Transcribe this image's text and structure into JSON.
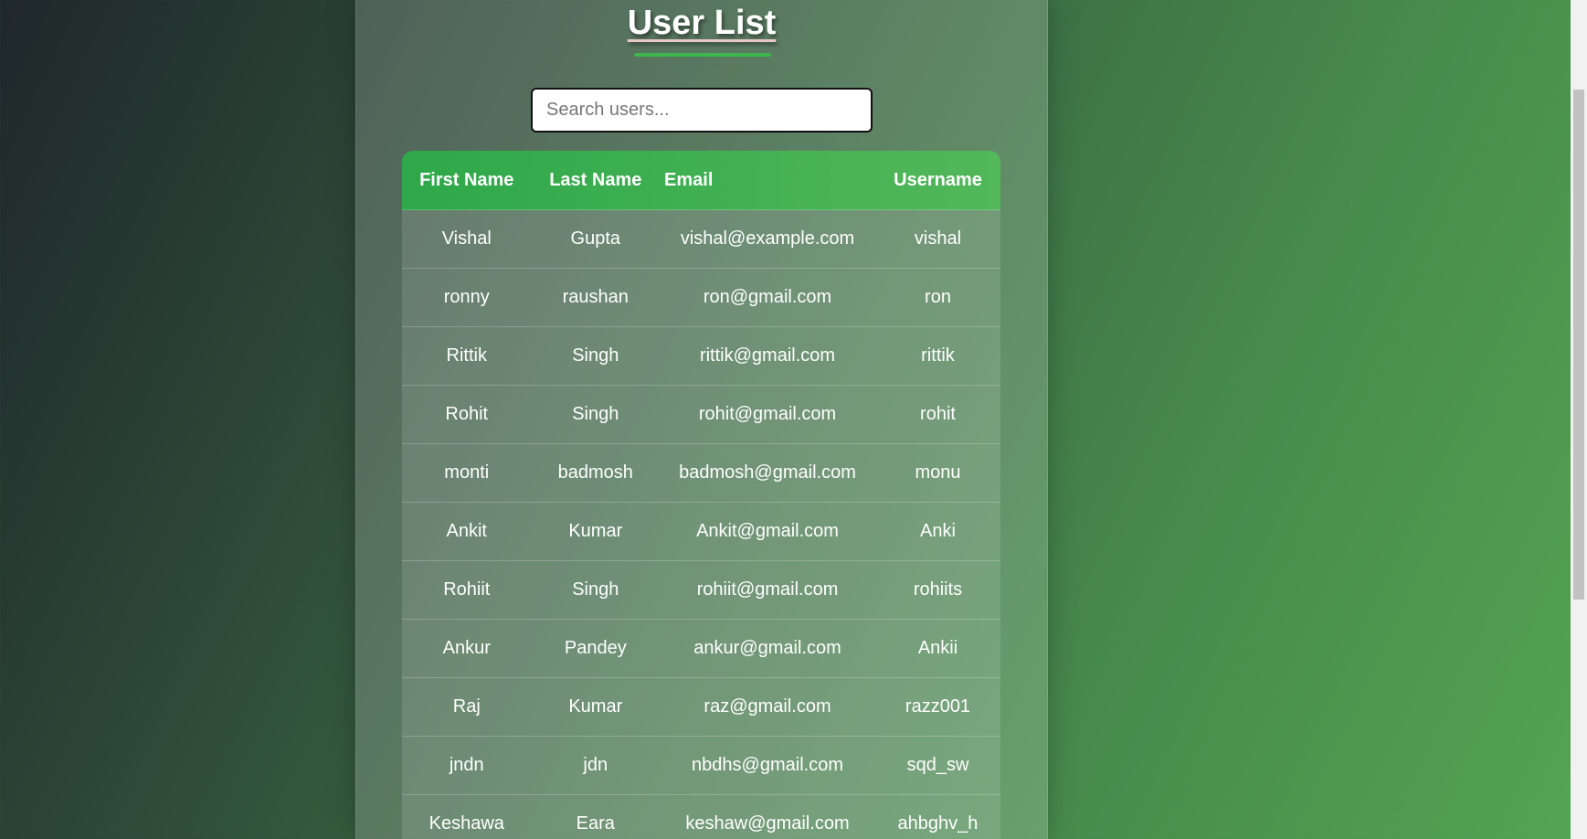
{
  "page": {
    "title": "User List",
    "search_placeholder": "Search users..."
  },
  "table": {
    "headers": [
      "First Name",
      "Last Name",
      "Email",
      "Username"
    ],
    "rows": [
      [
        "Vishal",
        "Gupta",
        "vishal@example.com",
        "vishal"
      ],
      [
        "ronny",
        "raushan",
        "ron@gmail.com",
        "ron"
      ],
      [
        "Rittik",
        "Singh",
        "rittik@gmail.com",
        "rittik"
      ],
      [
        "Rohit",
        "Singh",
        "rohit@gmail.com",
        "rohit"
      ],
      [
        "monti",
        "badmosh",
        "badmosh@gmail.com",
        "monu"
      ],
      [
        "Ankit",
        "Kumar",
        "Ankit@gmail.com",
        "Anki"
      ],
      [
        "Rohiit",
        "Singh",
        "rohiit@gmail.com",
        "rohiits"
      ],
      [
        "Ankur",
        "Pandey",
        "ankur@gmail.com",
        "Ankii"
      ],
      [
        "Raj",
        "Kumar",
        "raz@gmail.com",
        "razz001"
      ],
      [
        "jndn",
        "jdn",
        "nbdhs@gmail.com",
        "sqd_sw"
      ],
      [
        "Keshawa",
        "Eara",
        "keshaw@gmail.com",
        "ahbghv_h"
      ]
    ]
  },
  "colors": {
    "header_green": "#2ea84a",
    "title_underline": "#3fb54e"
  }
}
